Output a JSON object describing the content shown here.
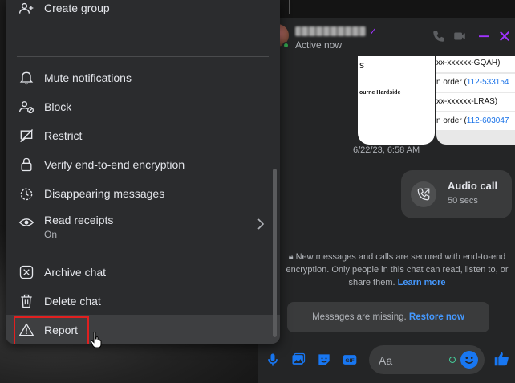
{
  "chat": {
    "status": "Active now",
    "card_left": {
      "line1": "s",
      "line2": "ourne Hardside"
    },
    "card_right": {
      "rows": [
        {
          "text": "xx-xxxxxx-GQAH)",
          "link": ""
        },
        {
          "text": "n order (",
          "link": "112-533154"
        },
        {
          "text": "xx-xxxxxx-LRAS)",
          "link": ""
        },
        {
          "text": "n order (",
          "link": "112-603047"
        }
      ]
    },
    "timestamp": "6/22/23, 6:58 AM",
    "audio_call": {
      "title": "Audio call",
      "duration": "50 secs"
    },
    "encryption": {
      "text": "New messages and calls are secured with end-to-end encryption. Only people in this chat can read, listen to, or share them.",
      "learn_more": "Learn more"
    },
    "missing": {
      "text": "Messages are missing.",
      "restore": "Restore now"
    },
    "composer": {
      "placeholder": "Aa"
    }
  },
  "menu": {
    "items": [
      {
        "label": "Create group",
        "icon": "create-group-icon"
      },
      {
        "label": "Mute notifications",
        "icon": "bell-icon"
      },
      {
        "label": "Block",
        "icon": "block-user-icon"
      },
      {
        "label": "Restrict",
        "icon": "restrict-icon"
      },
      {
        "label": "Verify end-to-end encryption",
        "icon": "lock-icon"
      },
      {
        "label": "Disappearing messages",
        "icon": "timer-icon"
      },
      {
        "label": "Read receipts",
        "sub": "On",
        "icon": "eye-icon"
      },
      {
        "label": "Archive chat",
        "icon": "archive-icon"
      },
      {
        "label": "Delete chat",
        "icon": "trash-icon"
      },
      {
        "label": "Report",
        "icon": "warning-icon"
      }
    ]
  },
  "colors": {
    "accent": "#a033ff",
    "link": "#4599ff",
    "highlight": "#e02020",
    "menu_bg": "#2b2c2e",
    "chat_bg": "#242526"
  }
}
